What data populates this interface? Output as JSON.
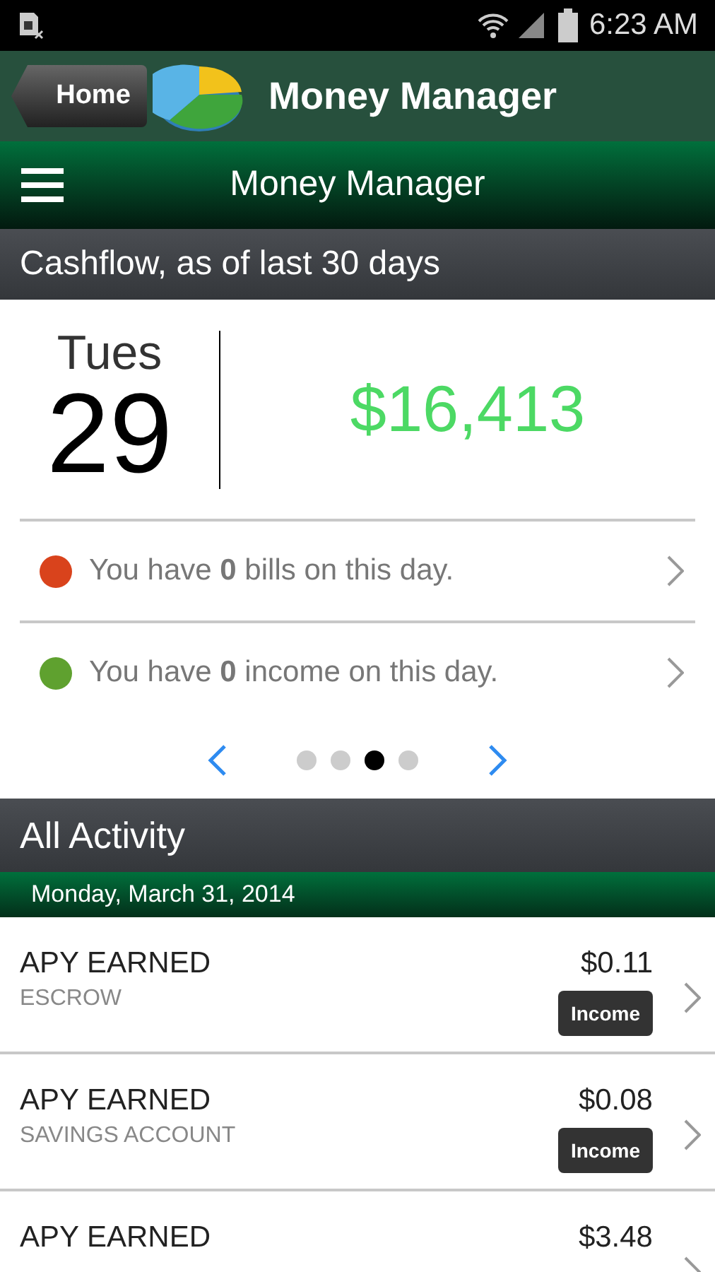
{
  "status_bar": {
    "time": "6:23 AM"
  },
  "header": {
    "back_label": "Home",
    "title": "Money Manager"
  },
  "nav": {
    "title": "Money Manager"
  },
  "cashflow": {
    "heading": "Cashflow, as of last 30 days",
    "weekday": "Tues",
    "day": "29",
    "amount": "$16,413",
    "summary": [
      {
        "color": "#d9431c",
        "text": "You have **0** bills on this day."
      },
      {
        "color": "#5fa12f",
        "text": "You have **0** income on this day."
      }
    ],
    "pager": [
      {
        "selected": false
      },
      {
        "selected": false
      },
      {
        "selected": true
      },
      {
        "selected": false
      }
    ]
  },
  "activity": {
    "heading": "All Activity",
    "date": "Monday, March 31, 2014",
    "rows": [
      {
        "title": "APY EARNED",
        "subtitle": "ESCROW",
        "amount": "$0.11",
        "badge": "Income"
      },
      {
        "title": "APY EARNED",
        "subtitle": "SAVINGS ACCOUNT",
        "amount": "$0.08",
        "badge": "Income"
      },
      {
        "title": "APY EARNED",
        "amount": "$3.48"
      }
    ]
  }
}
